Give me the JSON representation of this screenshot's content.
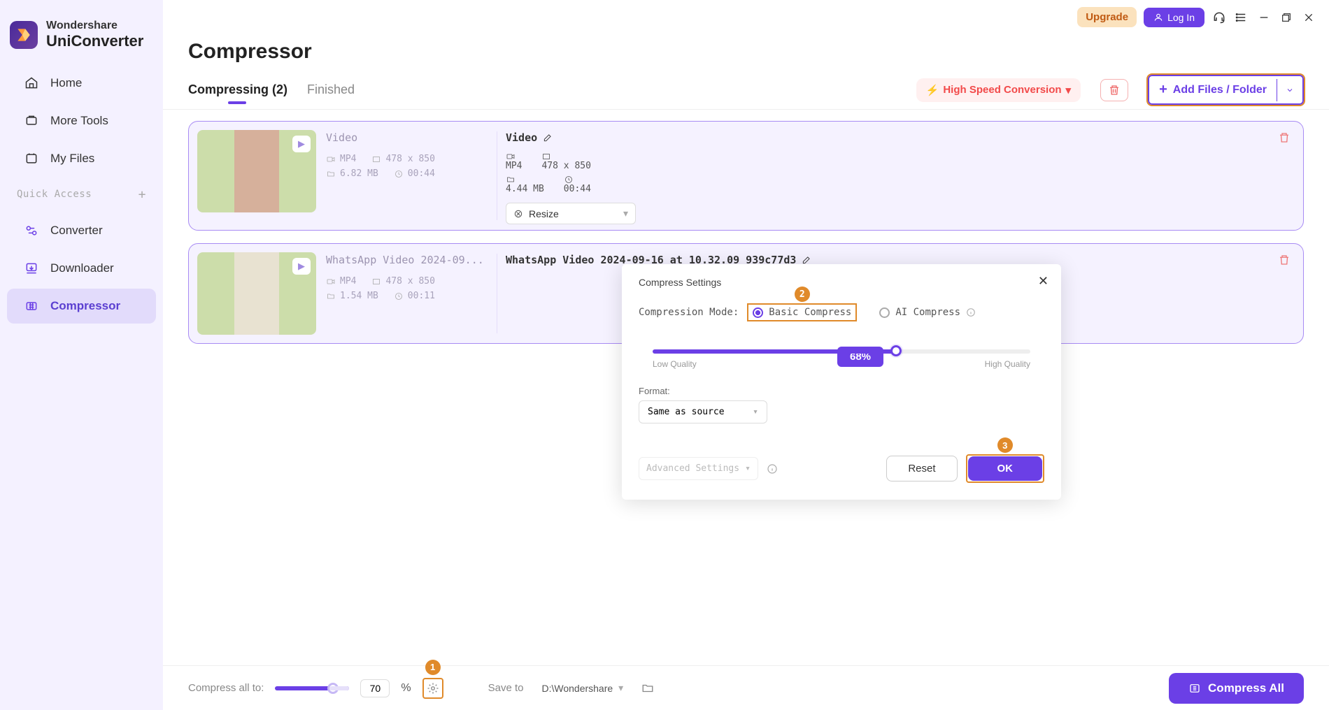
{
  "brand": {
    "top": "Wondershare",
    "bottom": "UniConverter"
  },
  "topbar": {
    "upgrade": "Upgrade",
    "login": "Log In"
  },
  "sidebar": {
    "items": [
      {
        "label": "Home"
      },
      {
        "label": "More Tools"
      },
      {
        "label": "My Files"
      }
    ],
    "quick_access": "Quick Access",
    "qa_items": [
      {
        "label": "Converter"
      },
      {
        "label": "Downloader"
      },
      {
        "label": "Compressor"
      }
    ]
  },
  "page_title": "Compressor",
  "tabs": {
    "compressing": "Compressing (2)",
    "finished": "Finished"
  },
  "actions": {
    "high_speed": "High Speed Conversion",
    "add": "Add Files / Folder"
  },
  "files": [
    {
      "src_title": "Video",
      "src_format": "MP4",
      "src_res": "478 x 850",
      "src_size": "6.82 MB",
      "src_dur": "00:44",
      "dst_title": "Video",
      "dst_format": "MP4",
      "dst_res": "478 x 850",
      "dst_size": "4.44 MB",
      "dst_dur": "00:44",
      "resize": "Resize"
    },
    {
      "src_title": "WhatsApp Video 2024-09...",
      "src_format": "MP4",
      "src_res": "478 x 850",
      "src_size": "1.54 MB",
      "src_dur": "00:11",
      "dst_title": "WhatsApp Video 2024-09-16 at 10.32.09_939c77d3"
    }
  ],
  "popup": {
    "title": "Compress Settings",
    "mode_label": "Compression Mode:",
    "basic": "Basic Compress",
    "ai": "AI Compress",
    "pct": "68%",
    "low": "Low Quality",
    "high": "High Quality",
    "format_label": "Format:",
    "format_value": "Same as source",
    "advanced": "Advanced Settings",
    "reset": "Reset",
    "ok": "OK"
  },
  "bottom": {
    "compress_all_to": "Compress all to:",
    "pct": "70",
    "pct_suffix": "%",
    "save_to": "Save to",
    "path": "D:\\Wondershare",
    "compress_all": "Compress All"
  },
  "callouts": {
    "b1": "1",
    "b2": "2",
    "b3": "3"
  }
}
